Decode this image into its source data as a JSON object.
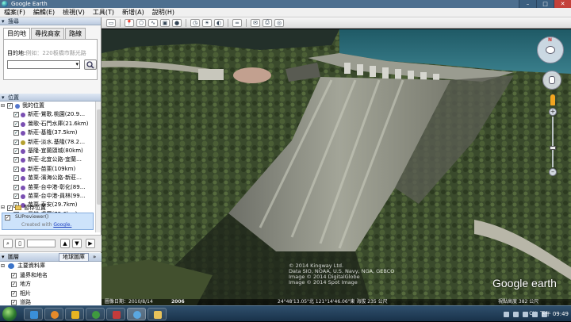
{
  "window": {
    "title": "Google Earth",
    "controls": [
      "–",
      "□",
      "✕"
    ]
  },
  "menu": [
    "檔案(F)",
    "編輯(E)",
    "檢視(V)",
    "工具(T)",
    "新增(A)",
    "說明(H)"
  ],
  "search": {
    "header": "搜尋",
    "tabs": [
      "目的地",
      "尋找商家",
      "路線"
    ],
    "dest_label": "目的地",
    "dest_placeholder": "例如：220板橋市縣光路",
    "search_icon": "magnifier-icon"
  },
  "places": {
    "header": "位置",
    "root": "我的位置",
    "items": [
      "新莊-鶯歌.桃園(20.9…",
      "鶯歌-石門水庫(21.6km)",
      "新莊-基隆(37.5km)",
      "新莊-淡水.基隆(78.2…",
      "基隆-宜蘭頭城(80km)",
      "新莊-北宜公路-宜蘭…",
      "新莊-苗栗(109km)",
      "苗栗-濱海公路-新莊…",
      "苗栗-台中港-彰化(89…",
      "苗栗-台中港-員林(99…",
      "苗栗-泰安(29.7km)",
      "員林-虎尾(75.6km)"
    ],
    "temp_header": "暫存位置",
    "selected_item": "SUPreviewer()",
    "created_with": "Created with",
    "created_link": "Google."
  },
  "layers": {
    "header_left": "圖層",
    "header_right": "地球圖庫",
    "items": [
      "主要資料庫",
      "邊界和地名",
      "地方",
      "相片",
      "道路"
    ]
  },
  "map": {
    "attribution_lines": [
      "© 2014 Kingway Ltd.",
      "Data SIO, NOAA, U.S. Navy, NGA, GEBCO",
      "Image © 2014 DigitalGlobe",
      "Image © 2014 Spot Image"
    ],
    "logo": "Google earth",
    "status_date": "圖像日期：2010/8/14",
    "status_year": "2006",
    "status_coords": "24°48'13.05\"北  121°14'46.06\"東  海拔 235 公尺",
    "status_eye": "視點高度 382 公尺"
  },
  "taskbar": {
    "time": "下午 09:49",
    "lang": "CH"
  },
  "colors": {
    "water": "#2e6b78",
    "dam": "#8c8f83",
    "forest": "#37472a",
    "sidebar_selected": "#cde3fb"
  }
}
